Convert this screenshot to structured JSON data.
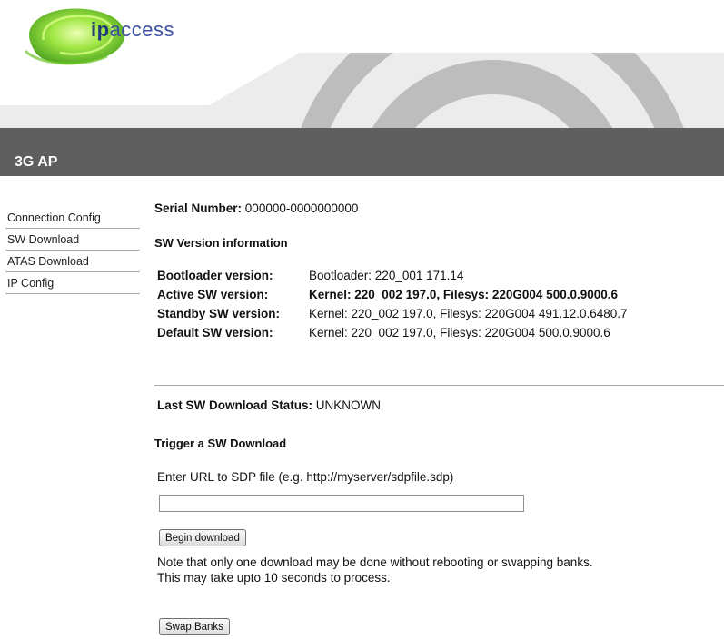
{
  "brand": {
    "logo_prefix": "ip",
    "logo_suffix": "access"
  },
  "title_bar": {
    "title": "3G AP"
  },
  "sidebar": {
    "items": [
      {
        "label": "Connection Config"
      },
      {
        "label": "SW Download"
      },
      {
        "label": "ATAS Download"
      },
      {
        "label": "IP Config"
      }
    ]
  },
  "main": {
    "serial": {
      "label": "Serial Number:",
      "value": "000000-0000000000"
    },
    "sw_version_heading": "SW Version information",
    "versions": [
      {
        "label": "Bootloader version:",
        "value": "Bootloader: 220_001 171.14",
        "bold": false
      },
      {
        "label": "Active SW version:",
        "value": "Kernel: 220_002 197.0, Filesys: 220G004 500.0.9000.6",
        "bold": true
      },
      {
        "label": "Standby SW version:",
        "value": "Kernel: 220_002 197.0, Filesys: 220G004 491.12.0.6480.7",
        "bold": false
      },
      {
        "label": "Default SW version:",
        "value": "Kernel: 220_002 197.0, Filesys: 220G004 500.0.9000.6",
        "bold": false
      }
    ],
    "last_status": {
      "label": "Last SW Download Status:",
      "value": "UNKNOWN"
    },
    "trigger_heading": "Trigger a SW Download",
    "url_label": "Enter URL to SDP file (e.g. http://myserver/sdpfile.sdp)",
    "url_input": {
      "value": "",
      "placeholder": ""
    },
    "begin_button": "Begin download",
    "note": "Note that only one download may be done without rebooting or swapping banks. This may take upto 10 seconds to process.",
    "swap_button": "Swap Banks"
  },
  "colors": {
    "title_bar": "#5f5f5f",
    "banner_gray": "#c8c8c8",
    "logo_green": "#7fd12a",
    "logo_blue": "#233a7a"
  }
}
